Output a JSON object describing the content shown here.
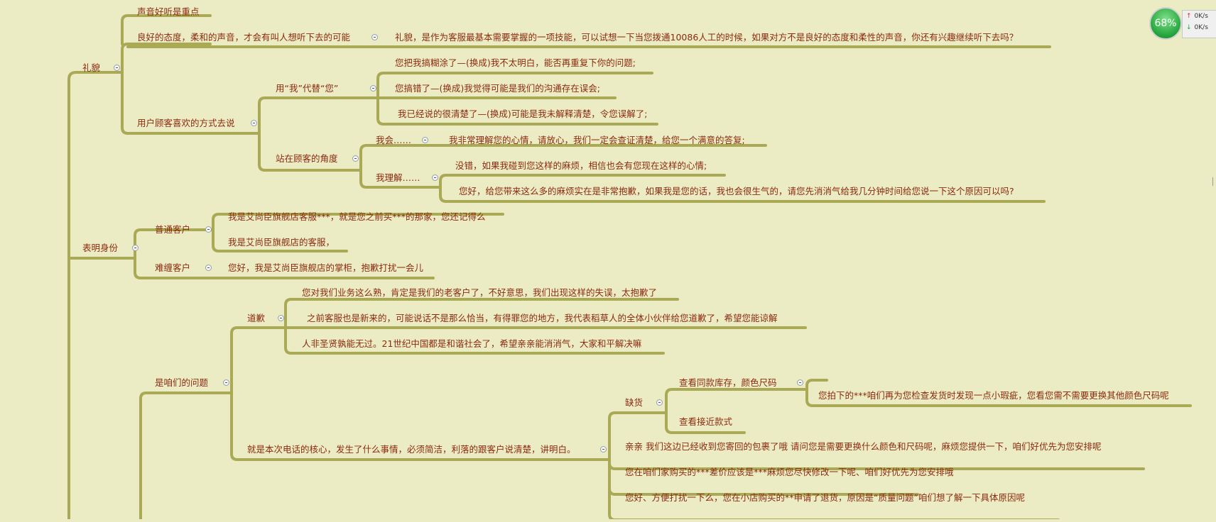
{
  "mindmap": {
    "branch_liyi": "礼貌",
    "voice_good": "声音好听是重点",
    "good_attitude": "良好的态度，柔和的声音，才会有叫人想听下去的可能",
    "liyi_desc": "礼貌，是作为客服最基本需要掌握的一项技能，可以试想一下当您拨通10086人工的时候，如果对方不是良好的态度和柔性的声音，你还有兴趣继续听下去吗？",
    "customer_way": "用户顾客喜欢的方式去说",
    "use_wo": "用“我”代替“您”",
    "wo_1": "您把我搞糊涂了—(换成)我不太明白，能否再重复下你的问题;",
    "wo_2": "您搞错了—(换成)我觉得可能是我们的沟通存在误会;",
    "wo_3": "我已经说的很清楚了—(换成)可能是我未解释清楚，令您误解了;",
    "stand_customer": "站在顾客的角度",
    "wo_hui": "我会……",
    "wo_hui_text": "我非常理解您的心情，请放心，我们一定会查证清楚，给您一个满意的答复;",
    "wo_lijie": "我理解……",
    "lijie_1": "没错，如果我碰到您这样的麻烦，相信也会有您现在这样的心情;",
    "lijie_2": "您好，给您带来这么多的麻烦实在是非常抱歉，如果我是您的话，我也会很生气的，请您先消消气给我几分钟时间给您说一下这个原因可以吗?",
    "branch_identity": "表明身份",
    "normal_customer": "普通客户",
    "normal_1": "我是艾尚臣旗舰店客服***，就是您之前买***的那家，您还记得么",
    "normal_2": "我是艾尚臣旗舰店的客服，",
    "hard_customer": "难缠客户",
    "hard_1": "您好，我是艾尚臣旗舰店的掌柜，抱歉打扰一会儿",
    "our_problem": "是咱们的问题",
    "apology": "道歉",
    "apology_1": "您对我们业务这么熟，肯定是我们的老客户了，不好意思，我们出现这样的失误，太抱歉了",
    "apology_2": "之前客服也是新来的，可能说话不是那么恰当，有得罪您的地方，我代表稻草人的全体小伙伴给您道歉了，希望您能谅解",
    "apology_3": "人非圣贤孰能无过。21世纪中国都是和谐社会了，希望亲亲能消消气，大家和平解决嘛",
    "core": "就是本次电话的核心，发生了什么事情，必须简洁，利落的跟客户说清楚，讲明白。",
    "out_of_stock": "缺货",
    "check_stock": "查看同款库存，颜色尺码",
    "check_stock_text": "您拍下的***咱们再为您检查发货时发现一点小瑕疵，您看您需不需要更换其他颜色尺码呢",
    "check_similar": "查看接近款式",
    "qinqin": "亲亲    我们这边已经收到您寄回的包裹了哦    请问您是需要更换什么颜色和尺码呢，麻烦您提供一下，咱们好优先为您安排呢",
    "price_diff": "您在咱们家购买的***差价应该是***麻烦您尽快修改一下呢、咱们好优先为您安排哦",
    "refund": "您好、方便打扰一下么，您在小店购买的**申请了退货，原因是“质量问题”咱们想了解一下具体原因呢"
  },
  "speed_widget": {
    "percent": "68%",
    "up": "0K/s",
    "down": "0K/s",
    "up_arrow": "↑",
    "down_arrow": "↓"
  },
  "colors": {
    "background": "#ececc4",
    "branch_line": "#aaa955",
    "node_text": "#8a2a10",
    "widget_green": "#23a43a"
  }
}
